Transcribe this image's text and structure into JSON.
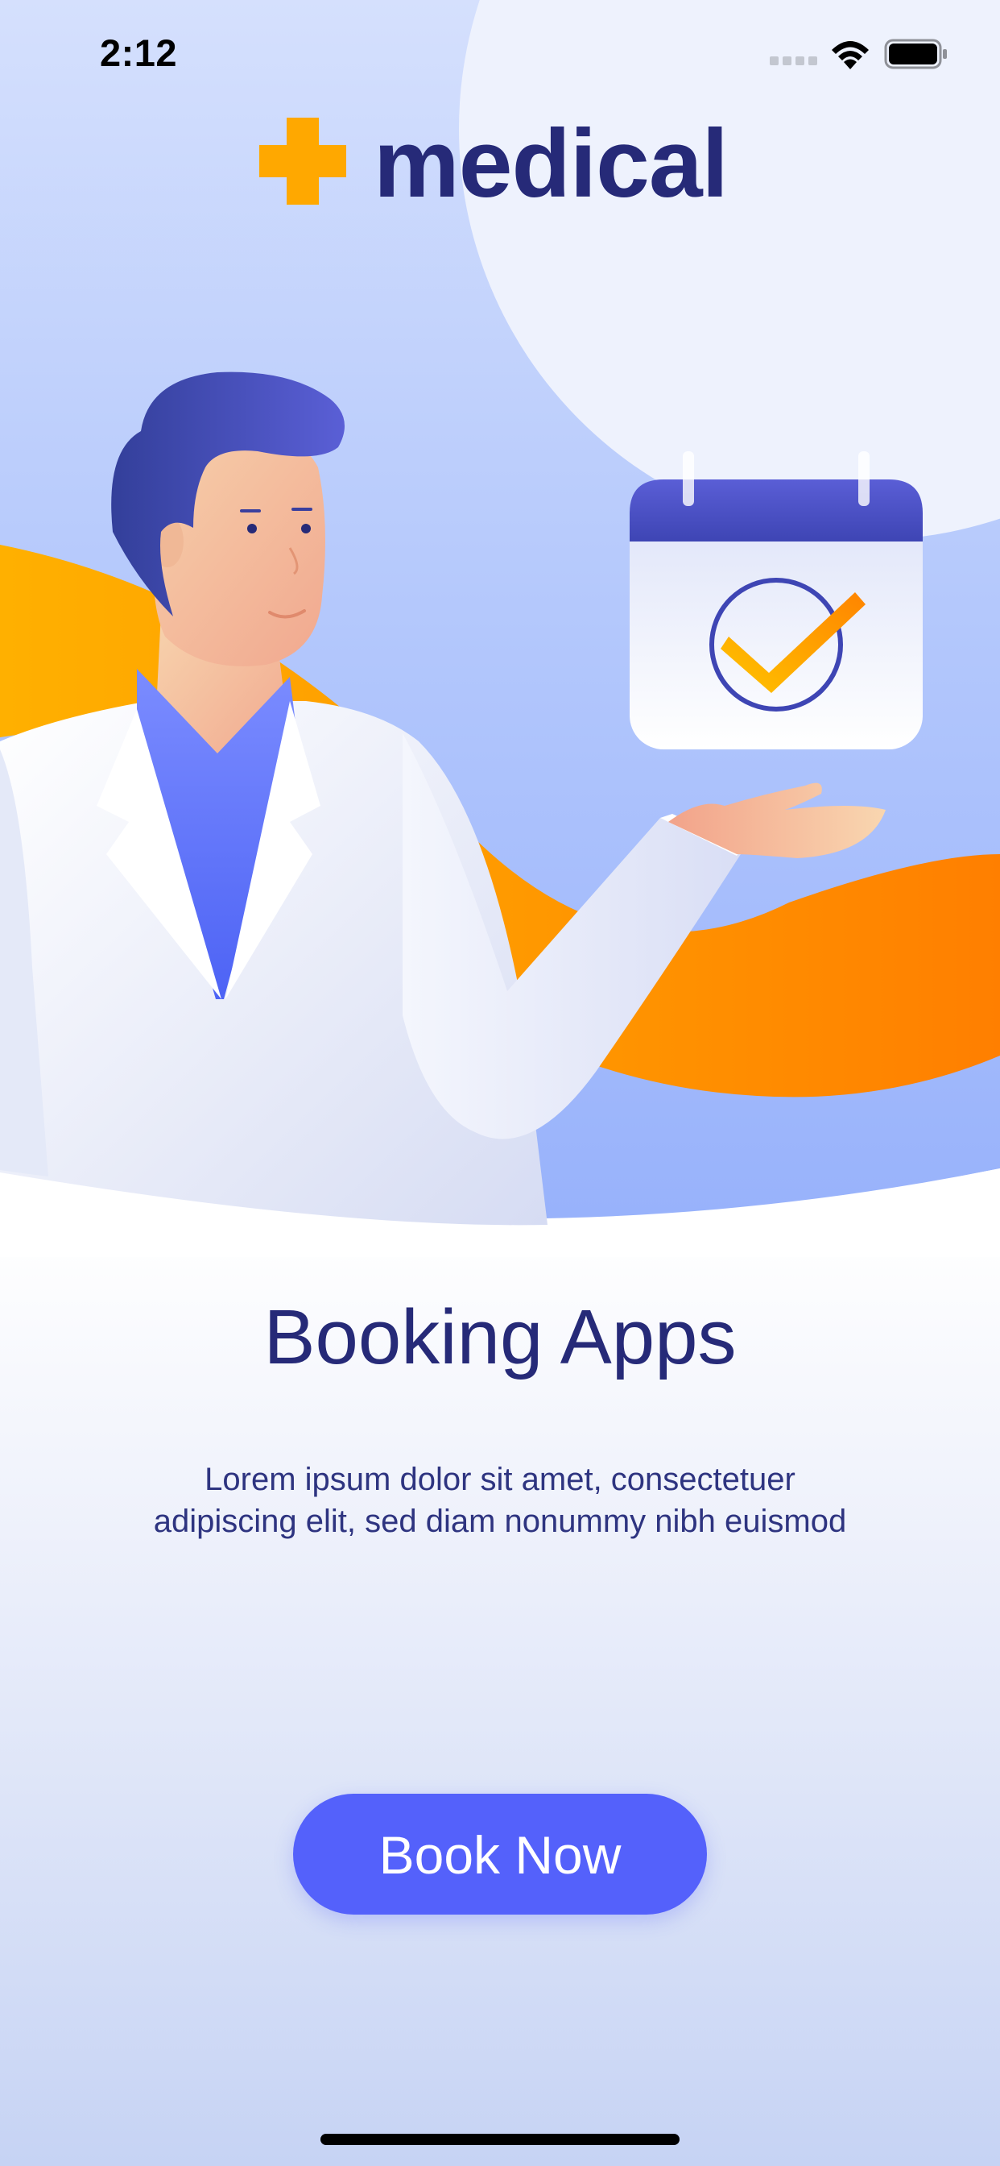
{
  "status_bar": {
    "time": "2:12",
    "icons": [
      "cellular-signal-icon",
      "wifi-icon",
      "battery-icon"
    ]
  },
  "brand": {
    "logo_icon": "plus-cross-icon",
    "name": "medical",
    "logo_color": "#ffa800",
    "name_color": "#262a78"
  },
  "illustration": {
    "subject": "doctor-holding-calendar",
    "icons": [
      "calendar-icon",
      "checkmark-icon"
    ]
  },
  "content": {
    "title": "Booking Apps",
    "description_line1": "Lorem ipsum dolor sit amet, consectetuer",
    "description_line2": "adipiscing elit, sed diam nonummy nibh euismod"
  },
  "actions": {
    "book_now_label": "Book Now"
  },
  "colors": {
    "accent": "#5461fb",
    "primary_text": "#262a78",
    "orange": "#ff8c00",
    "hero_blue": "#9fb6fb"
  }
}
